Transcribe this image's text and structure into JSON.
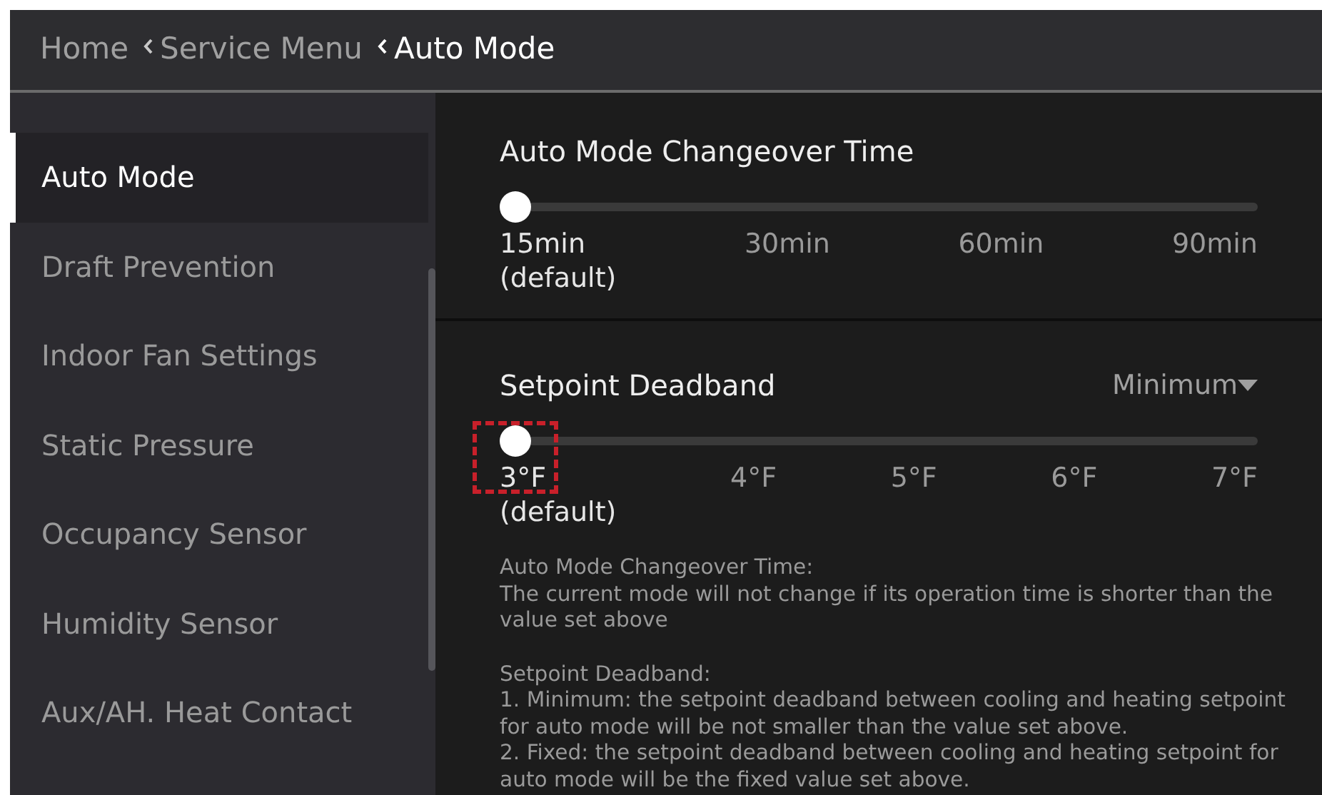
{
  "breadcrumb": [
    {
      "label": "Home",
      "current": false
    },
    {
      "label": "Service Menu",
      "current": false
    },
    {
      "label": "Auto Mode",
      "current": true
    }
  ],
  "sidebar": {
    "items": [
      {
        "label": "Auto Mode",
        "selected": true
      },
      {
        "label": "Draft Prevention",
        "selected": false
      },
      {
        "label": "Indoor Fan Settings",
        "selected": false
      },
      {
        "label": "Static Pressure",
        "selected": false
      },
      {
        "label": "Occupancy Sensor",
        "selected": false
      },
      {
        "label": "Humidity Sensor",
        "selected": false
      },
      {
        "label": "Aux/AH. Heat Contact",
        "selected": false
      }
    ]
  },
  "settings": [
    {
      "title": "Auto Mode Changeover Time",
      "level": 0,
      "highlighted": false,
      "ticks": [
        {
          "label": "15min",
          "note": "(default)"
        },
        {
          "label": "30min"
        },
        {
          "label": "60min"
        },
        {
          "label": "90min"
        }
      ]
    },
    {
      "title": "Setpoint Deadband",
      "dropdown": "Minimum",
      "level": 0,
      "highlighted": true,
      "ticks": [
        {
          "label": "3°F",
          "note": "(default)"
        },
        {
          "label": "4°F"
        },
        {
          "label": "5°F"
        },
        {
          "label": "6°F"
        },
        {
          "label": "7°F"
        }
      ]
    }
  ],
  "help": [
    [
      "Auto Mode Changeover Time:",
      "The current mode will not change if its operation time is shorter than the value set above"
    ],
    [
      "Setpoint Deadband:",
      "1.  Minimum: the setpoint deadband between cooling and heating setpoint for auto mode will be not smaller than the value set above.",
      "2.  Fixed: the setpoint deadband between cooling and heating setpoint for auto mode will be the fixed value set above."
    ]
  ]
}
